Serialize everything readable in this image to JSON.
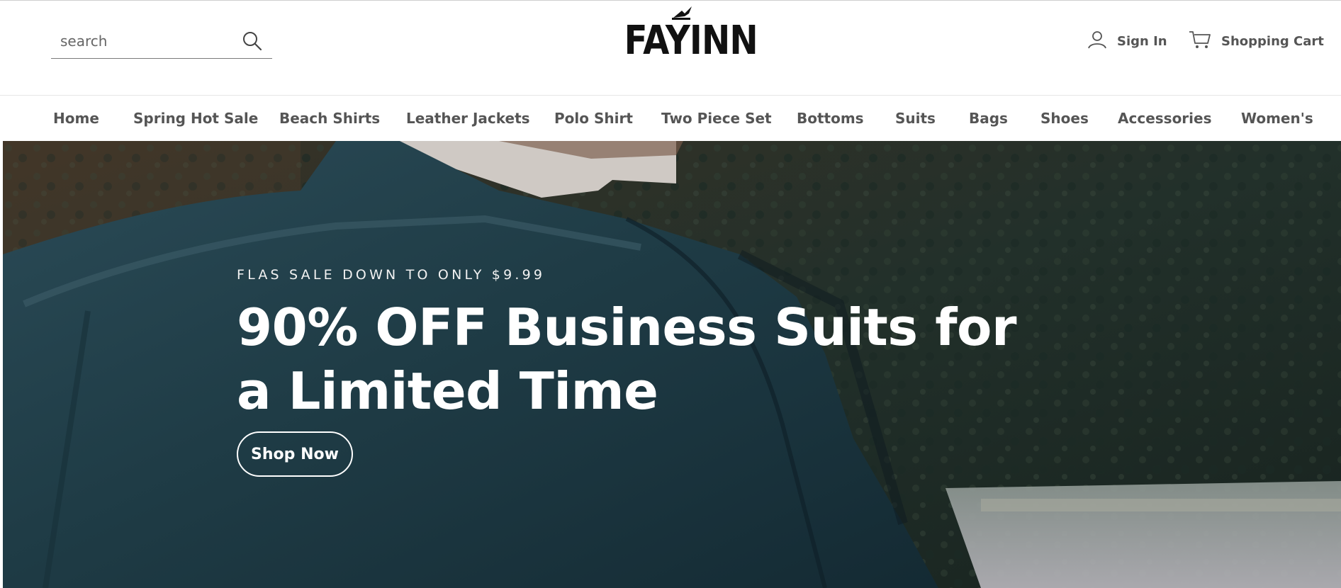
{
  "brand": {
    "name": "FAYINN"
  },
  "search": {
    "placeholder": "search"
  },
  "header": {
    "sign_in_label": "Sign In",
    "cart_label": "Shopping Cart"
  },
  "nav": {
    "items": [
      {
        "label": "Home"
      },
      {
        "label": "Spring Hot Sale"
      },
      {
        "label": "Beach Shirts"
      },
      {
        "label": "Leather Jackets"
      },
      {
        "label": "Polo Shirt"
      },
      {
        "label": "Two Piece Set"
      },
      {
        "label": "Bottoms"
      },
      {
        "label": "Suits"
      },
      {
        "label": "Bags"
      },
      {
        "label": "Shoes"
      },
      {
        "label": "Accessories"
      },
      {
        "label": "Women's"
      }
    ]
  },
  "hero": {
    "eyebrow": "FLAS SALE DOWN TO ONLY $9.99",
    "title": "90% OFF Business Suits for a Limited Time",
    "cta_label": "Shop Now"
  },
  "icons": {
    "search": "search-icon",
    "user": "user-icon",
    "cart": "cart-icon"
  },
  "colors": {
    "nav_text": "#555555",
    "hero_text": "#ffffff",
    "jacket": "#1f3c46"
  }
}
